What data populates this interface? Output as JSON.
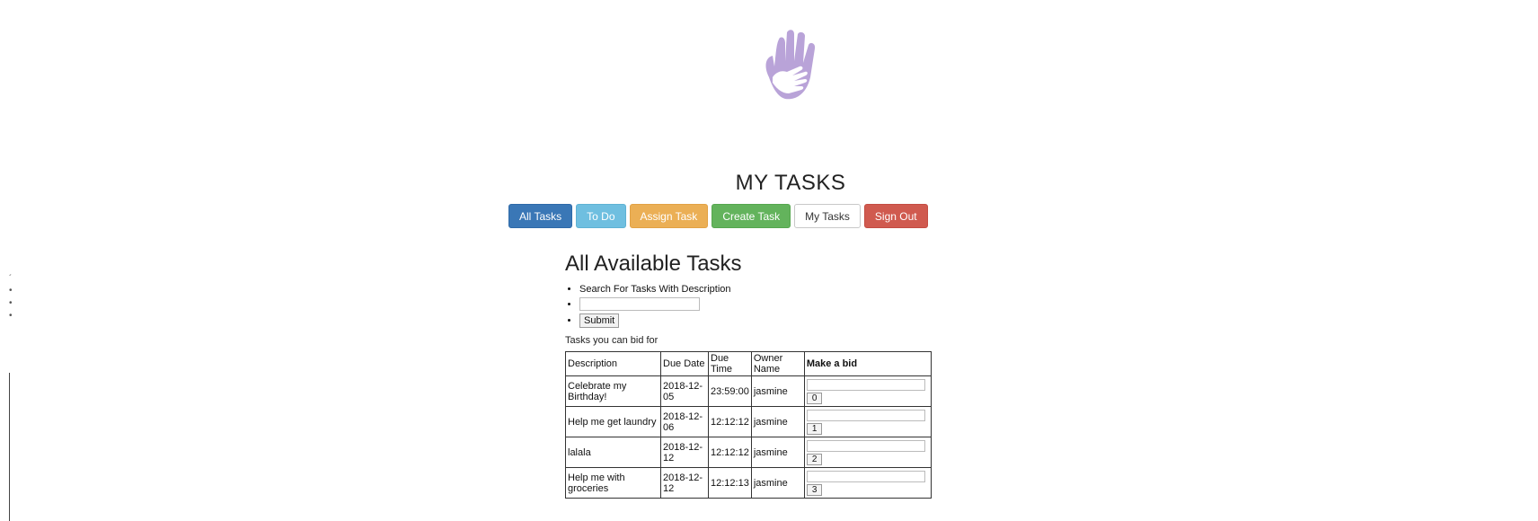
{
  "header": {
    "title": "MY TASKS"
  },
  "nav": {
    "all_tasks": "All Tasks",
    "to_do": "To Do",
    "assign_task": "Assign Task",
    "create_task": "Create Task",
    "my_tasks": "My Tasks",
    "sign_out": "Sign Out"
  },
  "main": {
    "heading": "All Available Tasks",
    "search": {
      "label": "Search For Tasks With Description",
      "value": "",
      "submit_label": "Submit"
    },
    "subheading": "Tasks you can bid for",
    "table": {
      "headers": [
        "Description",
        "Due Date",
        "Due Time",
        "Owner Name",
        "Make a bid"
      ],
      "rows": [
        {
          "description": "Celebrate my Birthday!",
          "due_date": "2018-12-05",
          "due_time": "23:59:00",
          "owner": "jasmine",
          "bid_button": "0"
        },
        {
          "description": "Help me get laundry",
          "due_date": "2018-12-06",
          "due_time": "12:12:12",
          "owner": "jasmine",
          "bid_button": "1"
        },
        {
          "description": "lalala",
          "due_date": "2018-12-12",
          "due_time": "12:12:12",
          "owner": "jasmine",
          "bid_button": "2"
        },
        {
          "description": "Help me with groceries",
          "due_date": "2018-12-12",
          "due_time": "12:12:13",
          "owner": "jasmine",
          "bid_button": "3"
        }
      ]
    }
  },
  "colors": {
    "logo": "#b9a3d8",
    "primary": "#3a77b6",
    "info": "#6fbfe0",
    "warning": "#ebaf55",
    "success": "#63b35c",
    "danger": "#d05a4f"
  },
  "icons": {
    "logo": "hands-logo-icon"
  }
}
